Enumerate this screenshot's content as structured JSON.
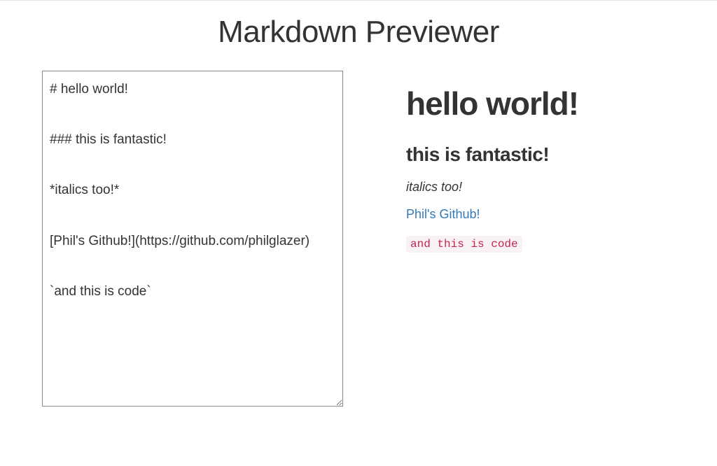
{
  "header": {
    "title": "Markdown Previewer"
  },
  "editor": {
    "raw_markdown": "# hello world!\n\n### this is fantastic!\n\n*italics too!*\n\n[Phil's Github!](https://github.com/philglazer)\n\n`and this is code`"
  },
  "preview": {
    "h1": "hello world!",
    "h3": "this is fantastic!",
    "italic": "italics too!",
    "link_text": "Phil's Github!",
    "code": "and this is code"
  }
}
